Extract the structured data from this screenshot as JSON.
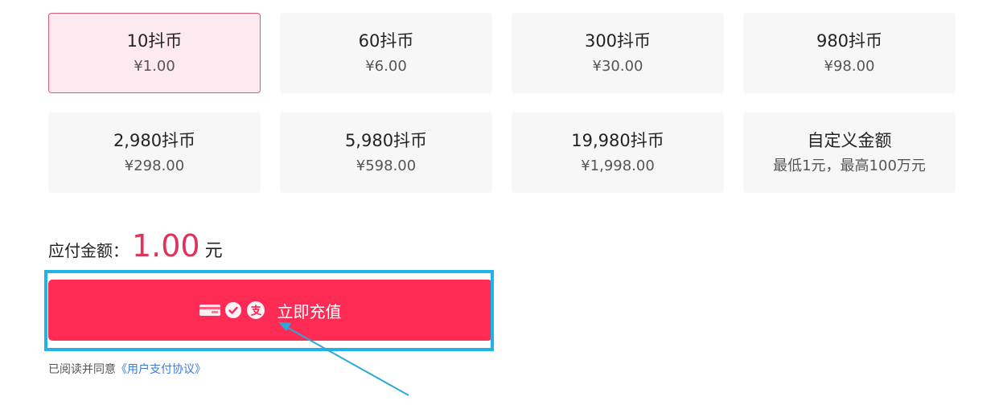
{
  "packages": [
    {
      "amount": "10抖币",
      "price": "¥1.00",
      "selected": true
    },
    {
      "amount": "60抖币",
      "price": "¥6.00",
      "selected": false
    },
    {
      "amount": "300抖币",
      "price": "¥30.00",
      "selected": false
    },
    {
      "amount": "980抖币",
      "price": "¥98.00",
      "selected": false
    },
    {
      "amount": "2,980抖币",
      "price": "¥298.00",
      "selected": false
    },
    {
      "amount": "5,980抖币",
      "price": "¥598.00",
      "selected": false
    },
    {
      "amount": "19,980抖币",
      "price": "¥1,998.00",
      "selected": false
    },
    {
      "amount": "自定义金额",
      "price": "最低1元，最高100万元",
      "selected": false
    }
  ],
  "payment": {
    "due_label": "应付金额：",
    "due_value": "1.00",
    "due_unit": "元",
    "button_label": "立即充值",
    "icons": [
      "bank-card-icon",
      "wechat-pay-icon",
      "alipay-icon"
    ]
  },
  "agreement": {
    "prefix": "已阅读并同意",
    "link": "《用户支付协议》"
  },
  "colors": {
    "accent": "#fe2c55",
    "due_value": "#e0325a",
    "selected_bg": "#fdeaf0",
    "selected_border": "#e2567a",
    "highlight": "#22b3e6",
    "link": "#3a7bd5"
  }
}
